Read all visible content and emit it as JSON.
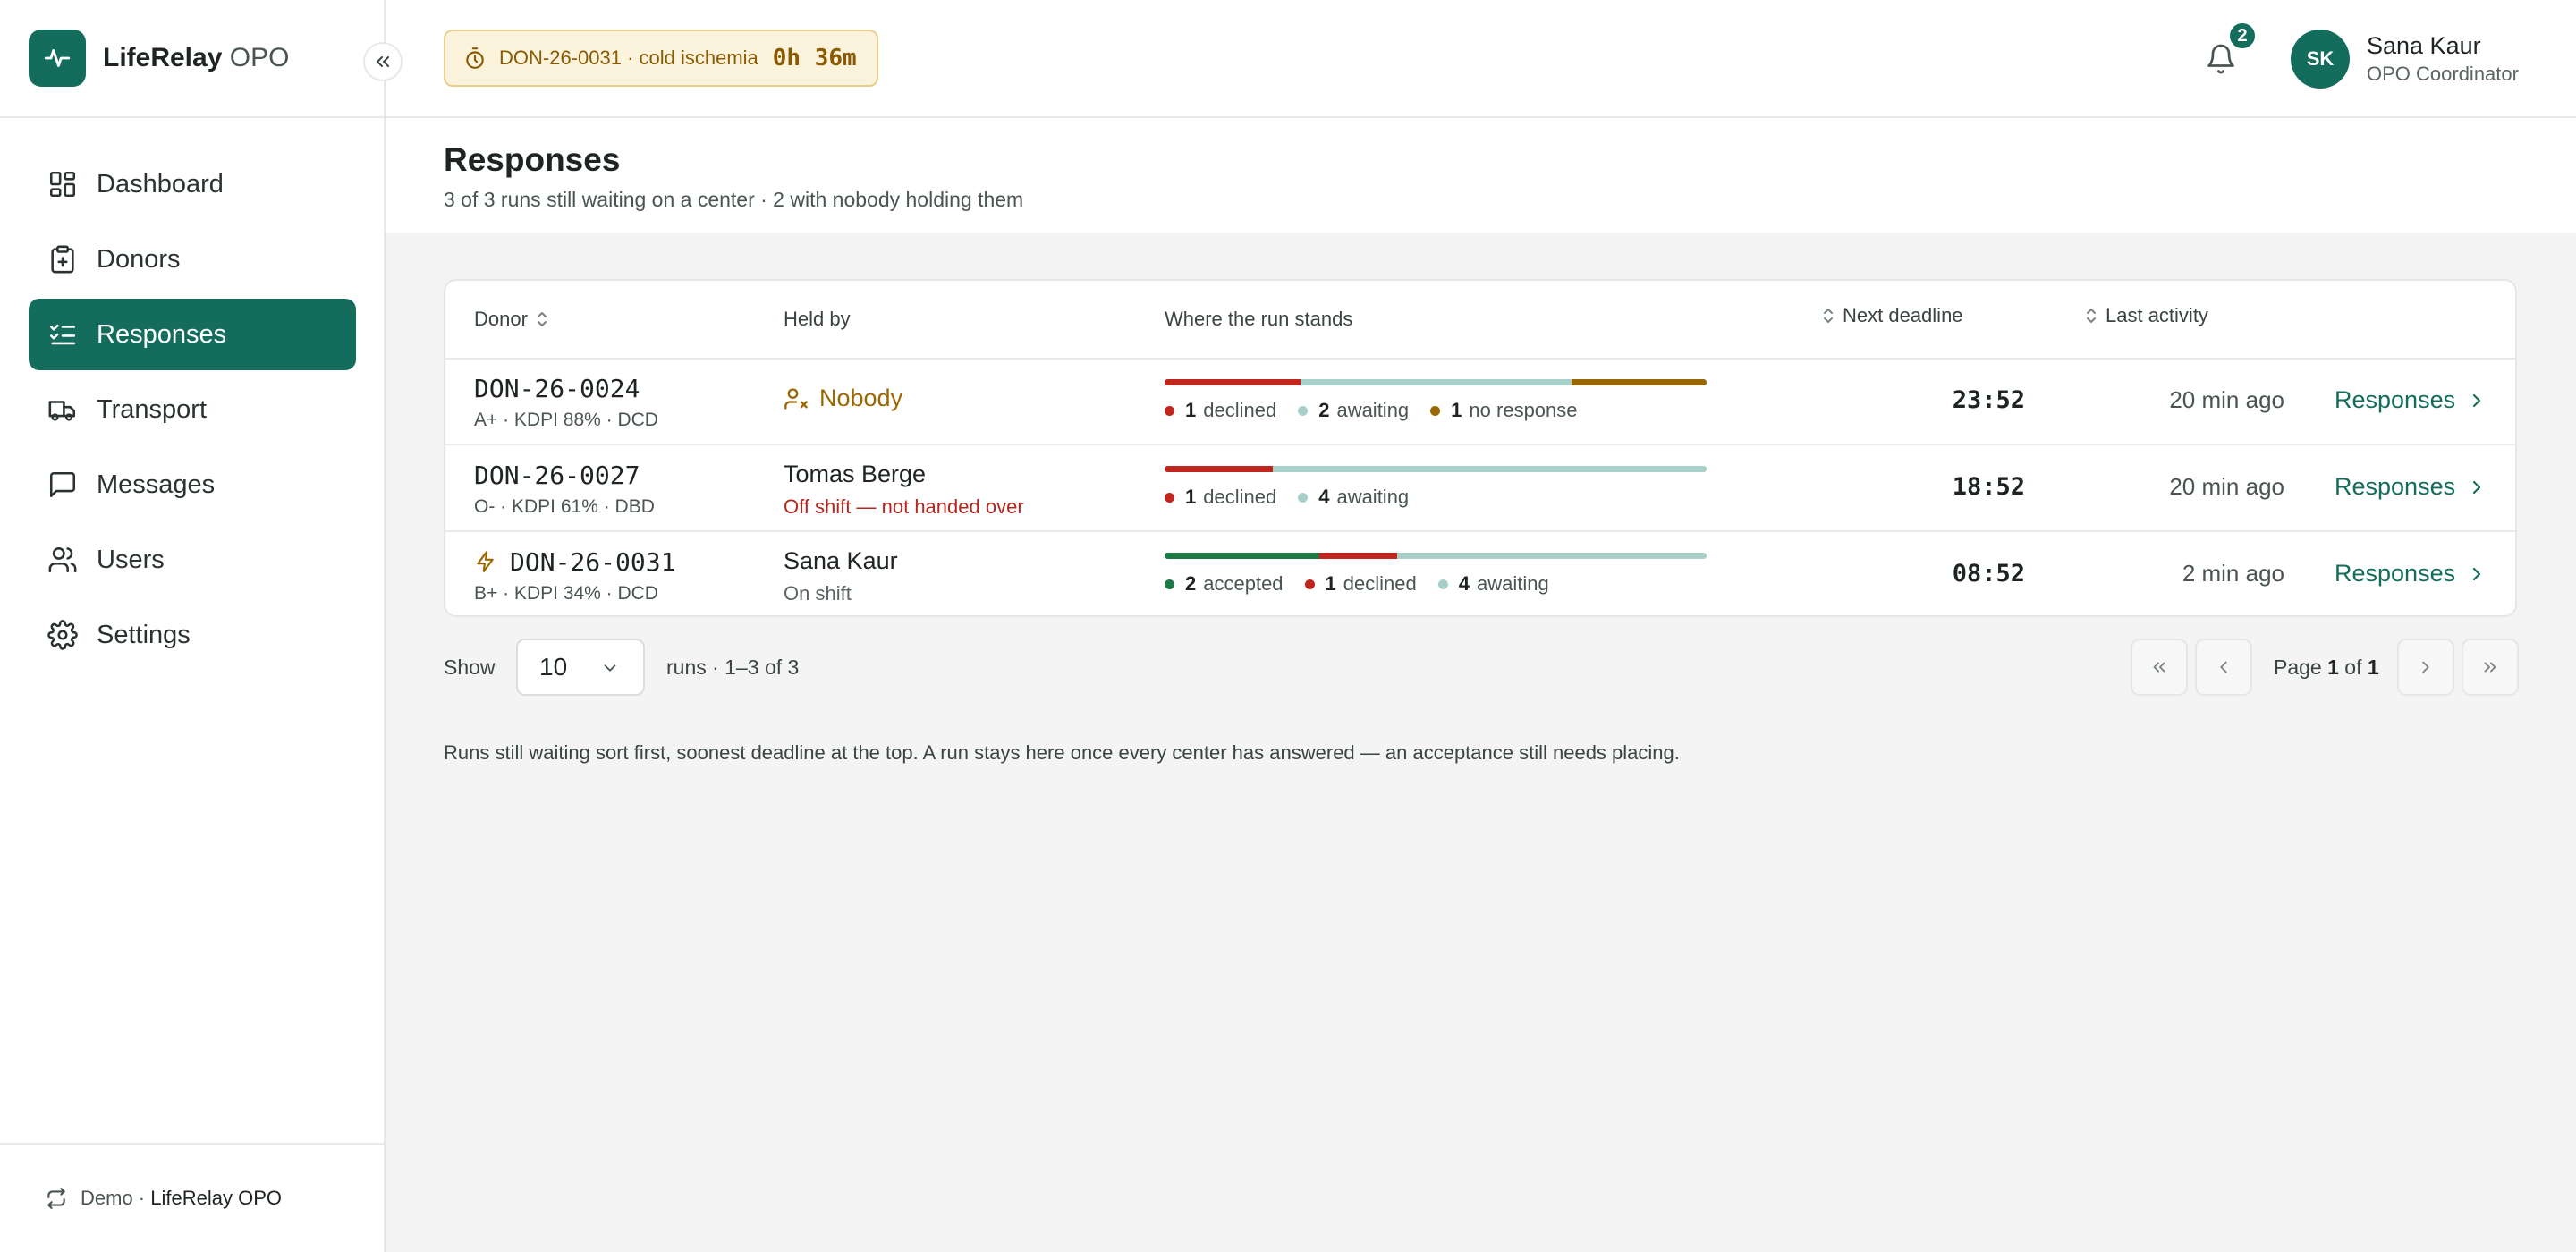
{
  "brand": {
    "name": "LifeRelay",
    "suffix": "OPO"
  },
  "nav": [
    {
      "label": "Dashboard",
      "icon": "dashboard-icon",
      "active": false
    },
    {
      "label": "Donors",
      "icon": "clipboard-plus-icon",
      "active": false
    },
    {
      "label": "Responses",
      "icon": "list-checks-icon",
      "active": true
    },
    {
      "label": "Transport",
      "icon": "truck-icon",
      "active": false
    },
    {
      "label": "Messages",
      "icon": "message-square-icon",
      "active": false
    },
    {
      "label": "Users",
      "icon": "users-icon",
      "active": false
    },
    {
      "label": "Settings",
      "icon": "gear-icon",
      "active": false
    }
  ],
  "sidebar_footer": {
    "prefix": "Demo · ",
    "org": "LifeRelay OPO"
  },
  "header": {
    "ischemia_label": "DON-26-0031 · cold ischemia",
    "ischemia_time": "0h 36m",
    "notification_count": "2",
    "user": {
      "initials": "SK",
      "name": "Sana Kaur",
      "role": "OPO Coordinator"
    }
  },
  "page": {
    "title": "Responses",
    "subtitle": "3 of 3 runs still waiting on a center · 2 with nobody holding them"
  },
  "table": {
    "columns": {
      "donor": "Donor",
      "held_by": "Held by",
      "status": "Where the run stands",
      "deadline": "Next deadline",
      "activity": "Last activity"
    },
    "rows": [
      {
        "donor_id": "DON-26-0024",
        "donor_meta": "A+ · KDPI 88% · DCD",
        "urgent": false,
        "held_by": "Nobody",
        "held_nobody": true,
        "held_sub": "",
        "bar": {
          "accepted": 0,
          "declined": 1,
          "awaiting": 2,
          "no_response": 1
        },
        "legend": [
          {
            "count": "1",
            "label": "declined",
            "color": "#c0261d"
          },
          {
            "count": "2",
            "label": "awaiting",
            "color": "#a8cfc8"
          },
          {
            "count": "1",
            "label": "no response",
            "color": "#9a6700"
          }
        ],
        "deadline": "23:52",
        "activity": "20 min ago",
        "action": "Responses"
      },
      {
        "donor_id": "DON-26-0027",
        "donor_meta": "O- · KDPI 61% · DBD",
        "urgent": false,
        "held_by": "Tomas Berge",
        "held_nobody": false,
        "held_sub": "Off shift — not handed over",
        "held_sub_warn": true,
        "bar": {
          "accepted": 0,
          "declined": 1,
          "awaiting": 4,
          "no_response": 0
        },
        "legend": [
          {
            "count": "1",
            "label": "declined",
            "color": "#c0261d"
          },
          {
            "count": "4",
            "label": "awaiting",
            "color": "#a8cfc8"
          }
        ],
        "deadline": "18:52",
        "activity": "20 min ago",
        "action": "Responses"
      },
      {
        "donor_id": "DON-26-0031",
        "donor_meta": "B+ · KDPI 34% · DCD",
        "urgent": true,
        "held_by": "Sana Kaur",
        "held_nobody": false,
        "held_sub": "On shift",
        "held_sub_warn": false,
        "bar": {
          "accepted": 2,
          "declined": 1,
          "awaiting": 4,
          "no_response": 0
        },
        "legend": [
          {
            "count": "2",
            "label": "accepted",
            "color": "#1e7a45"
          },
          {
            "count": "1",
            "label": "declined",
            "color": "#c0261d"
          },
          {
            "count": "4",
            "label": "awaiting",
            "color": "#a8cfc8"
          }
        ],
        "deadline": "08:52",
        "activity": "2 min ago",
        "action": "Responses"
      }
    ]
  },
  "pagination": {
    "show_label": "Show",
    "page_size": "10",
    "runs_label": "runs · 1–3 of 3",
    "page_prefix": "Page",
    "page_current": "1",
    "page_of": "of",
    "page_total": "1"
  },
  "footnote": "Runs still waiting sort first, soonest deadline at the top. A run stays here once every center has answered — an acceptance still needs placing.",
  "colors": {
    "brand": "#146c5c",
    "declined": "#c0261d",
    "accepted": "#1e7a45",
    "awaiting": "#a8cfc8",
    "no_response": "#9a6700",
    "warning_bg": "#fcf3dc"
  }
}
